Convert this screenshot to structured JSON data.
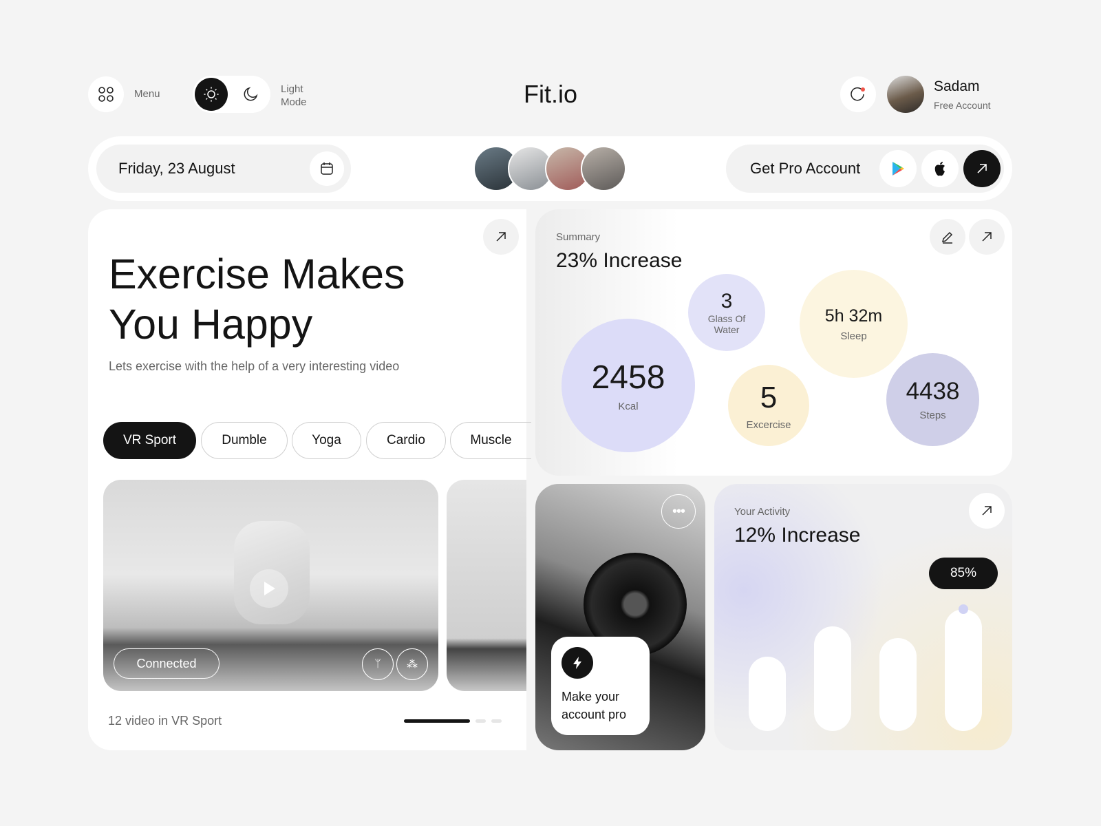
{
  "header": {
    "menu_label": "Menu",
    "theme_label_1": "Light",
    "theme_label_2": "Mode",
    "theme": "light",
    "brand": "Fit.io",
    "user": {
      "name": "Sadam",
      "plan": "Free Account"
    }
  },
  "toolbar": {
    "date": "Friday, 23 August",
    "pro_label": "Get Pro Account"
  },
  "hero": {
    "title_1": "Exercise Makes",
    "title_2": "You Happy",
    "subtitle": "Lets exercise with the help of a very interesting video",
    "categories": [
      "VR Sport",
      "Dumble",
      "Yoga",
      "Cardio",
      "Muscle"
    ],
    "active_category": "VR Sport",
    "video_status": "Connected",
    "footer": "12 video in VR Sport"
  },
  "summary": {
    "label": "Summary",
    "headline": "23% Increase",
    "stats": {
      "kcal": {
        "value": "2458",
        "label": "Kcal"
      },
      "water": {
        "value": "3",
        "label": "Glass Of Water"
      },
      "exercise": {
        "value": "5",
        "label": "Excercise"
      },
      "sleep": {
        "value": "5h 32m",
        "label": "Sleep"
      },
      "steps": {
        "value": "4438",
        "label": "Steps"
      }
    },
    "colors": {
      "lavender": "#dcdcf8",
      "cream": "#fbf3dc",
      "steel": "#cfcfe8"
    }
  },
  "promo": {
    "text_1": "Make your",
    "text_2": "account pro"
  },
  "activity": {
    "label": "Your Activity",
    "headline": "12% Increase",
    "bars": [
      52,
      73,
      65,
      85
    ],
    "highlight": "85%"
  }
}
